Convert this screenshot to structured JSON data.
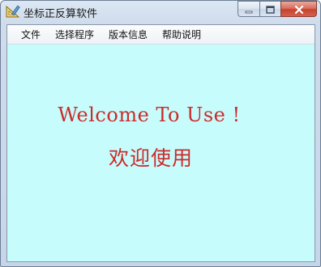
{
  "window": {
    "title": "坐标正反算软件",
    "icon": "ruler-triangle-icon"
  },
  "caption_buttons": {
    "minimize_icon": "minimize-icon",
    "maximize_icon": "maximize-icon",
    "close_icon": "close-icon"
  },
  "menu": {
    "items": [
      {
        "label": "文件"
      },
      {
        "label": "选择程序"
      },
      {
        "label": "版本信息"
      },
      {
        "label": "帮助说明"
      }
    ]
  },
  "content": {
    "welcome_en": "Welcome To Use !",
    "welcome_cn": "欢迎使用"
  },
  "colors": {
    "client_background": "#c7fcfc",
    "welcome_text": "#cc2a2a",
    "close_button": "#c5432f"
  }
}
